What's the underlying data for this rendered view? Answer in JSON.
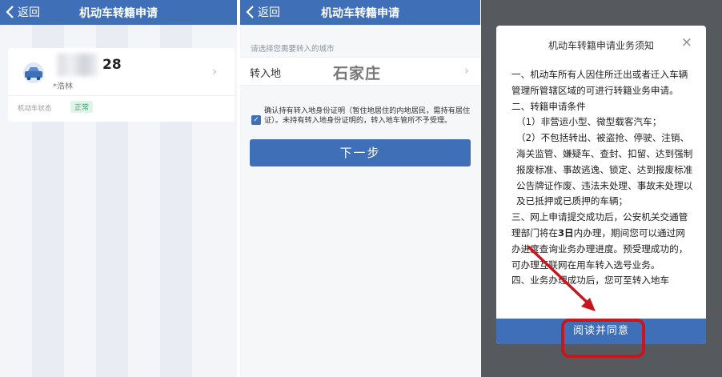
{
  "nav": {
    "back_label": "返回",
    "title": "机动车转籍申请"
  },
  "panel1": {
    "plate_partial": "28",
    "owner": "*浩林",
    "status_label": "机动车状态",
    "status_value": "正常"
  },
  "panel2": {
    "hint": "请选择您需要转入的城市",
    "city_label": "转入地",
    "city_value": "石家庄",
    "confirm_text": "确认持有转入地身份证明（暂住地居住的内地居民，需持有居住证）。未持有转入地身份证明的，转入地车管所不予受理。",
    "next_button": "下一步"
  },
  "modal": {
    "title": "机动车转籍申请业务须知",
    "p1": "一、机动车所有人因住所迁出或者迁入车辆管理所管辖区域的可进行转籍业务申请。",
    "p2": "二、转籍申请条件",
    "p3": "（1）非营运小型、微型载客汽车；",
    "p4": "（2）不包括转出、被盗抢、停驶、注销、海关监管、嫌疑车、查封、扣留、达到强制报废标准、事故逃逸、锁定、达到报废标准公告牌证作废、违法未处理、事故未处理以及已抵押或已质押的车辆；",
    "p5_a": "三、网上申请提交成功后，公安机关交通管理部门将在",
    "p5_b": "3日",
    "p5_c": "内办理，期间您可以通过网办进度查询业务办理进度。预受理成功的，可办理互联网在用车转入选号业务。",
    "p6": "四、业务办理成功后，您可至转入地车",
    "agree_button": "阅读并同意"
  },
  "colors": {
    "brand_blue": "#3f6fb6",
    "highlight_red": "#c8171c",
    "status_green": "#35a66b"
  }
}
